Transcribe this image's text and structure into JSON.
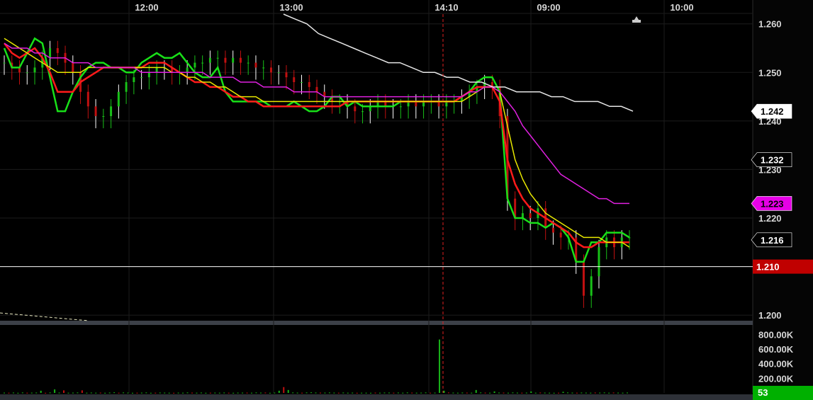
{
  "chart_data": [
    {
      "type": "candlestick",
      "x_tick_labels": [
        "12:00",
        "13:00",
        "14:10",
        "09:00",
        "10:00"
      ],
      "y_tick_labels": [
        "1.260",
        "1.250",
        "1.240",
        "1.230",
        "1.220",
        "1.200"
      ],
      "ylim": [
        1.199,
        1.262
      ],
      "grid": true,
      "price_line": {
        "value": 1.21,
        "label": "1.210",
        "color": "#c00000"
      },
      "price_tags": [
        {
          "label": "1.242",
          "value": 1.242,
          "bg": "#ffffff",
          "fg": "#000000"
        },
        {
          "label": "1.232",
          "value": 1.232,
          "bg": "#000000",
          "fg": "#ffffff"
        },
        {
          "label": "1.223",
          "value": 1.223,
          "bg": "#e600e6",
          "fg": "#000000"
        },
        {
          "label": "1.216",
          "value": 1.2155,
          "bg": "#000000",
          "fg": "#ffffff"
        }
      ],
      "close": [
        1.252,
        1.251,
        1.25,
        1.25,
        1.251,
        1.253,
        1.255,
        1.254,
        1.252,
        1.25,
        1.246,
        1.243,
        1.241,
        1.241,
        1.243,
        1.246,
        1.248,
        1.249,
        1.249,
        1.25,
        1.251,
        1.251,
        1.25,
        1.25,
        1.251,
        1.252,
        1.252,
        1.253,
        1.253,
        1.252,
        1.253,
        1.252,
        1.252,
        1.251,
        1.251,
        1.25,
        1.25,
        1.249,
        1.248,
        1.248,
        1.247,
        1.246,
        1.245,
        1.244,
        1.244,
        1.243,
        1.242,
        1.242,
        1.243,
        1.244,
        1.243,
        1.243,
        1.243,
        1.244,
        1.243,
        1.244,
        1.244,
        1.243,
        1.244,
        1.244,
        1.245,
        1.246,
        1.247,
        1.248,
        1.247,
        1.241,
        1.224,
        1.22,
        1.221,
        1.22,
        1.222,
        1.218,
        1.217,
        1.216,
        1.216,
        1.211,
        1.204,
        1.208,
        1.214,
        1.216,
        1.214,
        1.216,
        1.216
      ],
      "overlays": [
        {
          "name": "",
          "color": "#18e018",
          "values": [
            1.255,
            1.251,
            1.251,
            1.254,
            1.257,
            1.256,
            1.249,
            1.242,
            1.242,
            1.246,
            1.249,
            1.251,
            1.252,
            1.252,
            1.251,
            1.251,
            1.25,
            1.25,
            1.252,
            1.253,
            1.254,
            1.253,
            1.253,
            1.254,
            1.252,
            1.25,
            1.249,
            1.249,
            1.251,
            1.246,
            1.244,
            1.244,
            1.244,
            1.244,
            1.244,
            1.243,
            1.243,
            1.243,
            1.244,
            1.243,
            1.242,
            1.242,
            1.243,
            1.245,
            1.245,
            1.243,
            1.244,
            1.243,
            1.243,
            1.243,
            1.243,
            1.243,
            1.244,
            1.244,
            1.244,
            1.244,
            1.244,
            1.244,
            1.244,
            1.244,
            1.245,
            1.246,
            1.248,
            1.249,
            1.249,
            1.246,
            1.224,
            1.22,
            1.22,
            1.219,
            1.219,
            1.218,
            1.219,
            1.218,
            1.216,
            1.211,
            1.211,
            1.215,
            1.215,
            1.217,
            1.217,
            1.217,
            1.216
          ]
        },
        {
          "name": "",
          "color": "#ff1a1a",
          "values": [
            1.256,
            1.254,
            1.253,
            1.254,
            1.255,
            1.253,
            1.25,
            1.246,
            1.246,
            1.246,
            1.248,
            1.249,
            1.25,
            1.251,
            1.251,
            1.251,
            1.251,
            1.251,
            1.251,
            1.252,
            1.252,
            1.252,
            1.251,
            1.25,
            1.249,
            1.248,
            1.248,
            1.247,
            1.247,
            1.246,
            1.245,
            1.245,
            1.244,
            1.244,
            1.243,
            1.243,
            1.243,
            1.243,
            1.243,
            1.243,
            1.243,
            1.243,
            1.243,
            1.243,
            1.243,
            1.244,
            1.244,
            1.244,
            1.244,
            1.244,
            1.244,
            1.244,
            1.244,
            1.244,
            1.244,
            1.244,
            1.244,
            1.244,
            1.244,
            1.244,
            1.245,
            1.246,
            1.247,
            1.247,
            1.247,
            1.244,
            1.232,
            1.227,
            1.224,
            1.222,
            1.221,
            1.22,
            1.219,
            1.218,
            1.217,
            1.215,
            1.214,
            1.214,
            1.215,
            1.215,
            1.215,
            1.215,
            1.215
          ]
        },
        {
          "name": "",
          "color": "#e8e800",
          "values": [
            1.257,
            1.256,
            1.255,
            1.254,
            1.253,
            1.252,
            1.251,
            1.25,
            1.25,
            1.25,
            1.25,
            1.251,
            1.251,
            1.251,
            1.251,
            1.251,
            1.251,
            1.251,
            1.251,
            1.251,
            1.251,
            1.251,
            1.25,
            1.25,
            1.249,
            1.249,
            1.248,
            1.248,
            1.247,
            1.247,
            1.246,
            1.245,
            1.245,
            1.245,
            1.244,
            1.244,
            1.244,
            1.244,
            1.244,
            1.244,
            1.244,
            1.244,
            1.244,
            1.244,
            1.244,
            1.244,
            1.244,
            1.244,
            1.244,
            1.244,
            1.244,
            1.244,
            1.244,
            1.244,
            1.244,
            1.244,
            1.244,
            1.244,
            1.244,
            1.244,
            1.244,
            1.245,
            1.246,
            1.247,
            1.247,
            1.246,
            1.239,
            1.232,
            1.228,
            1.225,
            1.223,
            1.221,
            1.22,
            1.219,
            1.218,
            1.217,
            1.216,
            1.216,
            1.216,
            1.215,
            1.215,
            1.215,
            1.214
          ]
        },
        {
          "name": "",
          "color": "#e020e0",
          "values": [
            1.256,
            1.255,
            1.255,
            1.255,
            1.254,
            1.254,
            1.253,
            1.253,
            1.253,
            1.252,
            1.252,
            1.252,
            1.251,
            1.251,
            1.251,
            1.251,
            1.251,
            1.251,
            1.25,
            1.25,
            1.25,
            1.25,
            1.25,
            1.25,
            1.25,
            1.25,
            1.25,
            1.249,
            1.249,
            1.249,
            1.249,
            1.248,
            1.248,
            1.248,
            1.247,
            1.247,
            1.247,
            1.247,
            1.246,
            1.246,
            1.246,
            1.246,
            1.245,
            1.245,
            1.245,
            1.245,
            1.245,
            1.245,
            1.245,
            1.245,
            1.245,
            1.245,
            1.245,
            1.245,
            1.245,
            1.245,
            1.245,
            1.245,
            1.245,
            1.245,
            1.245,
            1.246,
            1.246,
            1.247,
            1.247,
            1.246,
            1.244,
            1.242,
            1.239,
            1.237,
            1.235,
            1.233,
            1.231,
            1.229,
            1.228,
            1.227,
            1.226,
            1.225,
            1.224,
            1.224,
            1.223,
            1.223,
            1.223
          ]
        },
        {
          "name": "",
          "color": "#e6e6e6",
          "values": [
            1.262,
            1.261,
            1.26,
            1.258,
            1.257,
            1.256,
            1.255,
            1.254,
            1.253,
            1.252,
            1.252,
            1.251,
            1.25,
            1.25,
            1.249,
            1.249,
            1.248,
            1.248,
            1.247,
            1.247,
            1.246,
            1.246,
            1.246,
            1.245,
            1.245,
            1.244,
            1.244,
            1.244,
            1.243,
            1.243,
            1.242
          ]
        }
      ],
      "volume": {
        "y_tick_labels": [
          "800.00K",
          "600.00K",
          "400.00K",
          "200.00K"
        ],
        "max": 900000,
        "current": {
          "label": "53",
          "color": "#00b000"
        },
        "values": [
          4000,
          3000,
          5000,
          2000,
          6000,
          3000,
          4000,
          5000,
          30000,
          2000,
          6000,
          48000,
          5000,
          35000,
          3000,
          4000,
          6000,
          35000,
          3000,
          5000,
          3000,
          4000,
          2000,
          5000,
          8000,
          3000,
          6000,
          4000,
          2000,
          3000,
          4000,
          6000,
          2000,
          3000,
          5000,
          4000,
          3000,
          2000,
          4000,
          3000,
          6000,
          4000,
          3000,
          5000,
          2000,
          3000,
          4000,
          3000,
          5000,
          3000,
          2000,
          4000,
          4000,
          4000,
          3000,
          6000,
          4000,
          5000,
          2000,
          4000,
          30000,
          80000,
          40000,
          6000,
          4000,
          3000,
          6000,
          8000,
          5000,
          4000,
          4000,
          6000,
          4000,
          3000,
          5000,
          3000,
          4000,
          2000,
          3000,
          3000,
          2000,
          4000,
          3000,
          5000,
          5000,
          3000,
          5000,
          3000,
          6000,
          4000,
          3000,
          4000,
          6000,
          3000,
          4000,
          730000,
          30000,
          6000,
          4000,
          3000,
          5000,
          4000,
          3000,
          40000,
          6000,
          4000,
          3000,
          20000,
          5000,
          4000,
          3000,
          6000,
          4000,
          3000,
          4000,
          20000,
          3000,
          5000,
          4000,
          3000,
          2000,
          3000,
          15000,
          6000,
          4000,
          3000,
          5000,
          4000,
          3000,
          5000,
          4000,
          6000,
          3000,
          5000,
          4000,
          3000,
          5000
        ]
      }
    }
  ]
}
